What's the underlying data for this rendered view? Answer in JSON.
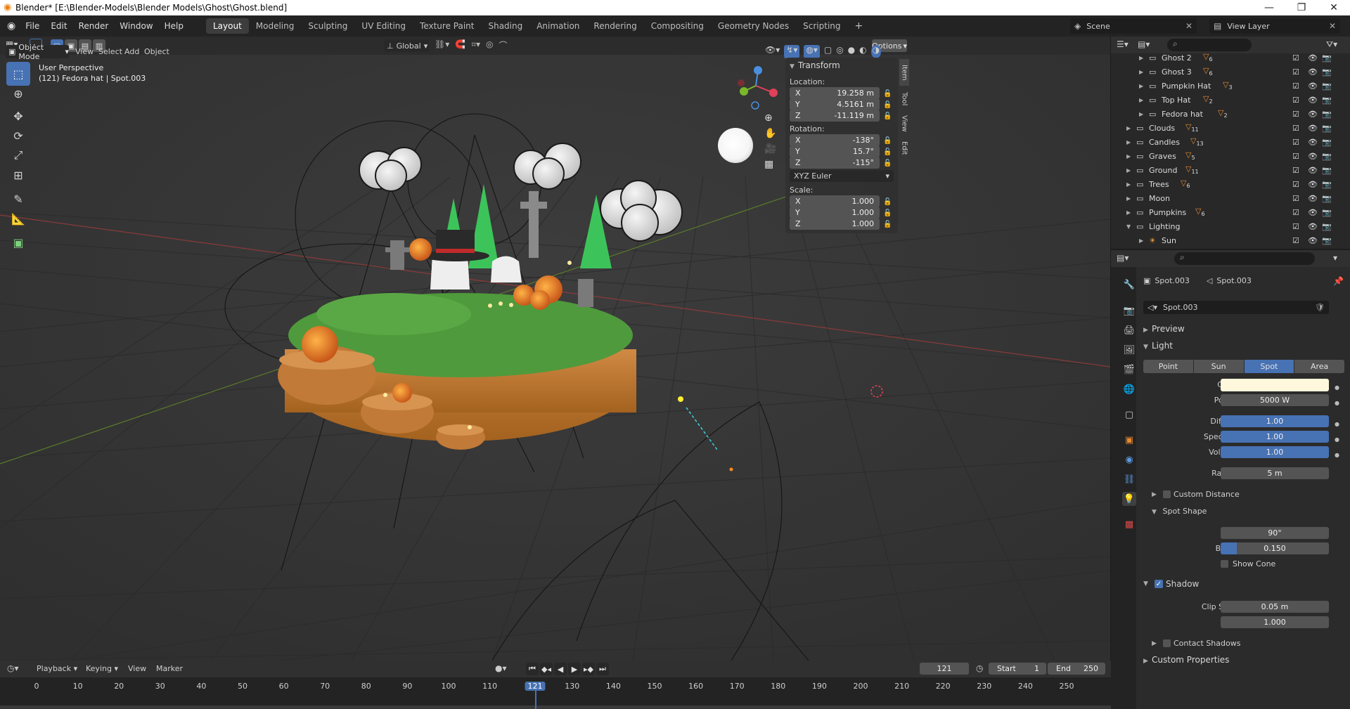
{
  "window": {
    "title": "Blender* [E:\\Blender-Models\\Blender Models\\Ghost\\Ghost.blend]"
  },
  "menus": [
    "File",
    "Edit",
    "Render",
    "Window",
    "Help"
  ],
  "workspaces": [
    "Layout",
    "Modeling",
    "Sculpting",
    "UV Editing",
    "Texture Paint",
    "Shading",
    "Animation",
    "Rendering",
    "Compositing",
    "Geometry Nodes",
    "Scripting"
  ],
  "active_workspace": "Layout",
  "scene": {
    "name": "Scene",
    "view_layer": "View Layer"
  },
  "viewport_header": {
    "orientation": "Global",
    "options": "Options",
    "mode": "Object Mode",
    "menus": [
      "View",
      "Select",
      "Add",
      "Object"
    ]
  },
  "viewport_info": {
    "line1": "User Perspective",
    "line2": "(121) Fedora hat | Spot.003"
  },
  "npanel": {
    "section": "Transform",
    "location_label": "Location:",
    "location": [
      {
        "axis": "X",
        "value": "19.258 m"
      },
      {
        "axis": "Y",
        "value": "4.5161 m"
      },
      {
        "axis": "Z",
        "value": "-11.119 m"
      }
    ],
    "rotation_label": "Rotation:",
    "rotation": [
      {
        "axis": "X",
        "value": "-138°"
      },
      {
        "axis": "Y",
        "value": "15.7°"
      },
      {
        "axis": "Z",
        "value": "-115°"
      }
    ],
    "rotation_mode": "XYZ Euler",
    "scale_label": "Scale:",
    "scale": [
      {
        "axis": "X",
        "value": "1.000"
      },
      {
        "axis": "Y",
        "value": "1.000"
      },
      {
        "axis": "Z",
        "value": "1.000"
      }
    ],
    "tabs": [
      "Item",
      "Tool",
      "View",
      "Edit"
    ]
  },
  "outliner": {
    "items": [
      {
        "name": "Ghost 2",
        "badge": "6",
        "indent": 2
      },
      {
        "name": "Ghost 3",
        "badge": "6",
        "indent": 2
      },
      {
        "name": "Pumpkin Hat",
        "badge": "3",
        "indent": 2
      },
      {
        "name": "Top Hat",
        "badge": "2",
        "indent": 2
      },
      {
        "name": "Fedora hat",
        "badge": "2",
        "indent": 2
      },
      {
        "name": "Clouds",
        "badge": "11",
        "indent": 1
      },
      {
        "name": "Candles",
        "badge": "13",
        "indent": 1
      },
      {
        "name": "Graves",
        "badge": "5",
        "indent": 1
      },
      {
        "name": "Ground",
        "badge": "11",
        "indent": 1
      },
      {
        "name": "Trees",
        "badge": "6",
        "indent": 1
      },
      {
        "name": "Moon",
        "badge": "",
        "indent": 1
      },
      {
        "name": "Pumpkins",
        "badge": "6",
        "indent": 1
      },
      {
        "name": "Lighting",
        "badge": "",
        "indent": 1
      },
      {
        "name": "Sun",
        "badge": "",
        "indent": 2
      }
    ]
  },
  "properties": {
    "object_name": "Spot.003",
    "data_name": "Spot.003",
    "datablock": "Spot.003",
    "preview": "Preview",
    "light": "Light",
    "light_types": [
      "Point",
      "Sun",
      "Spot",
      "Area"
    ],
    "active_type": "Spot",
    "color_label": "Color",
    "color": "#fff8dc",
    "power_label": "Power",
    "power": "5000 W",
    "diffuse_label": "Diffuse",
    "diffuse": "1.00",
    "specular_label": "Specular",
    "specular": "1.00",
    "volume_label": "Volume",
    "volume": "1.00",
    "radius_label": "Radius",
    "radius": "5 m",
    "custom_distance": "Custom Distance",
    "spot_shape": "Spot Shape",
    "size_label": "Size",
    "size": "90°",
    "blend_label": "Blend",
    "blend": "0.150",
    "blend_fraction": 0.15,
    "show_cone": "Show Cone",
    "shadow": "Shadow",
    "clip_start_label": "Clip Start",
    "clip_start": "0.05 m",
    "bias_label": "Bias",
    "bias": "1.000",
    "contact_shadows": "Contact Shadows",
    "custom_properties": "Custom Properties"
  },
  "timeline": {
    "menus": [
      "Playback",
      "Keying",
      "View",
      "Marker"
    ],
    "current_frame": "121",
    "start_label": "Start",
    "start": "1",
    "end_label": "End",
    "end": "250",
    "ticks": [
      "0",
      "10",
      "20",
      "30",
      "40",
      "50",
      "60",
      "70",
      "80",
      "90",
      "100",
      "110",
      "121",
      "130",
      "140",
      "150",
      "160",
      "170",
      "180",
      "190",
      "200",
      "210",
      "220",
      "230",
      "240",
      "250"
    ]
  },
  "colors": {
    "accent": "#4772b3",
    "grass": "#4f9a3c",
    "dirt": "#c97a35"
  }
}
